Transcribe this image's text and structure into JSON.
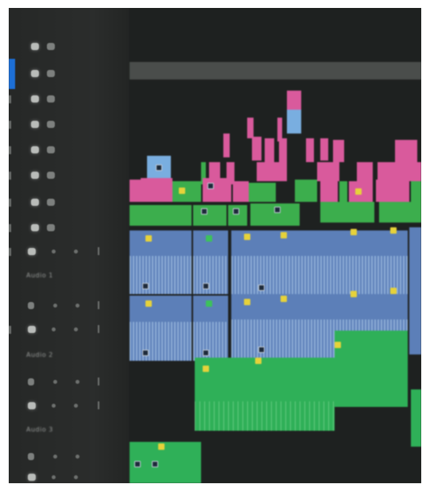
{
  "app": {
    "window_title": ""
  },
  "track_headers": {
    "names": [
      "Audio 1",
      "Audio 2",
      "Audio 3"
    ]
  },
  "colors": {
    "video_clip_pink": "#d95a9c",
    "video_clip_green": "#3cae4d",
    "video_clip_blue": "#79aee0",
    "audio_clip_blue": "#5c7fb8",
    "audio_clip_green": "#2fb058",
    "keyframe": "#e6d23a",
    "selection": "#1d6fd6",
    "panel_bg": "#262827",
    "timeline_bg": "#1e2120"
  },
  "icons": [
    "eye-icon",
    "lock-icon",
    "mute-icon",
    "solo-icon",
    "mic-icon"
  ]
}
